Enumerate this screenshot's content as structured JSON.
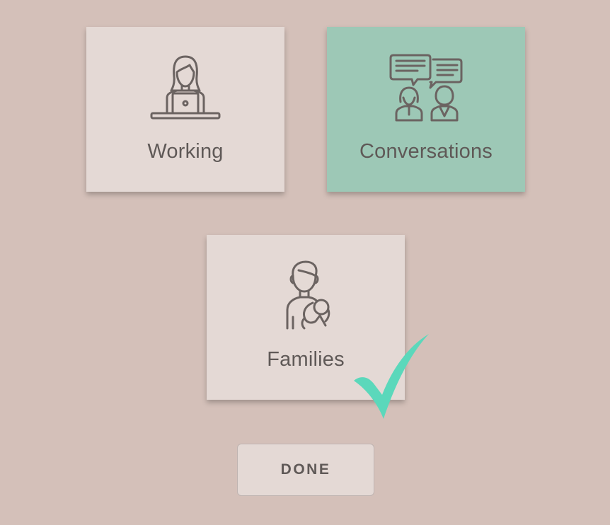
{
  "cards": [
    {
      "id": "working",
      "label": "Working",
      "icon": "person-at-laptop-icon",
      "selected": false
    },
    {
      "id": "conversations",
      "label": "Conversations",
      "icon": "two-people-speech-bubbles-icon",
      "selected": true
    },
    {
      "id": "families",
      "label": "Families",
      "icon": "parent-holding-baby-icon",
      "selected": false
    }
  ],
  "checkmark": {
    "icon": "checkmark-icon",
    "attached_to": "families",
    "color": "#5bd8bb"
  },
  "done_button": {
    "label": "DONE"
  },
  "colors": {
    "background": "#d4c0b9",
    "card": "#e4d9d5",
    "card_selected": "#9dc8b6",
    "text": "#5f5957",
    "icon_stroke": "#6b6361"
  }
}
